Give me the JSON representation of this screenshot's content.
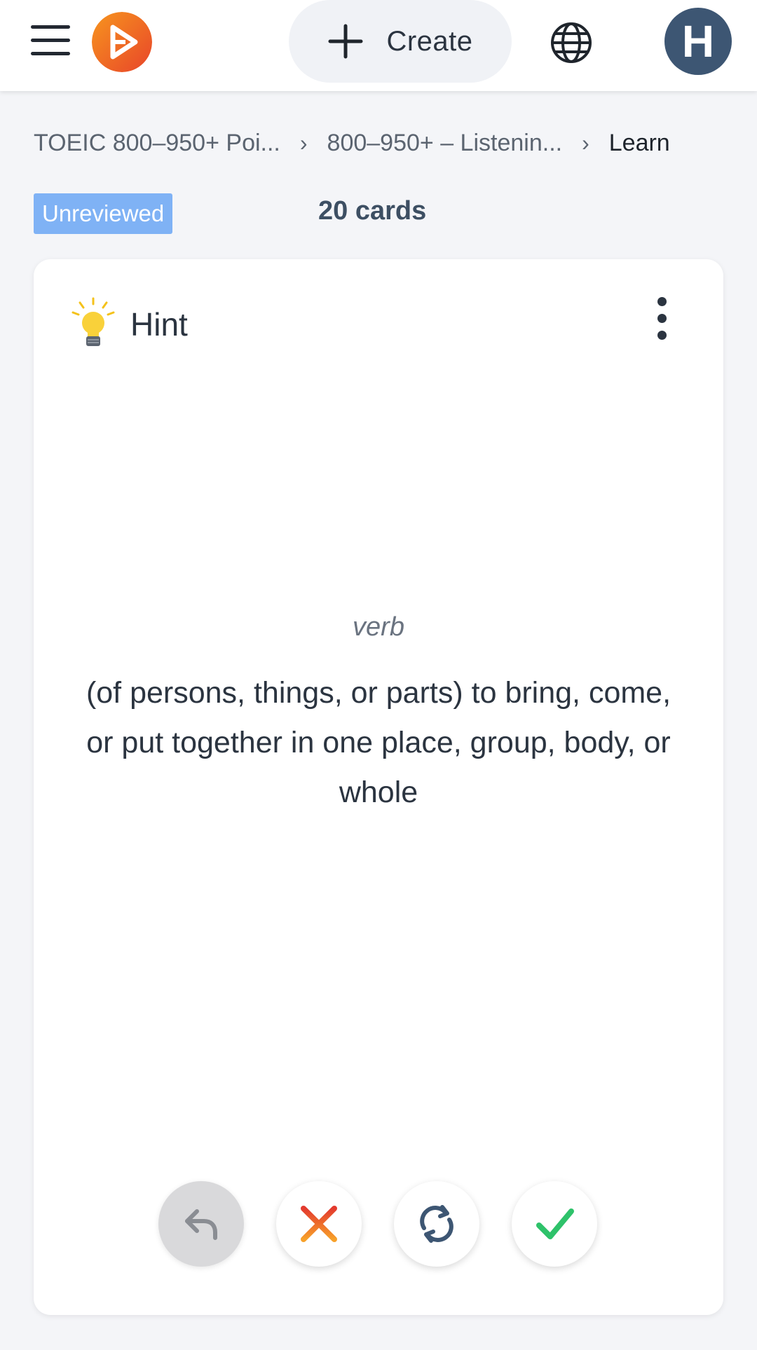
{
  "header": {
    "create_label": "Create",
    "avatar_initial": "H",
    "brand_colors": {
      "logo_start": "#f7951e",
      "logo_end": "#e8452a",
      "avatar_bg": "#3d5673"
    }
  },
  "breadcrumb": {
    "items": [
      "TOEIC 800–950+ Poi...",
      "800–950+ – Listenin...",
      "Learn"
    ]
  },
  "status": {
    "badge": "Unreviewed",
    "badge_color": "#7fb2f5",
    "card_count": "20 cards"
  },
  "card": {
    "hint_label": "Hint",
    "part_of_speech": "verb",
    "definition": "(of persons, things, or parts) to bring, come, or put together in one place, group, body, or whole"
  },
  "icons": {
    "menu": "hamburger-icon",
    "globe": "globe-icon",
    "hint": "lightbulb-icon",
    "more": "more-vertical-icon",
    "undo": "undo-icon",
    "wrong": "x-icon",
    "flip": "refresh-icon",
    "right": "check-icon"
  }
}
